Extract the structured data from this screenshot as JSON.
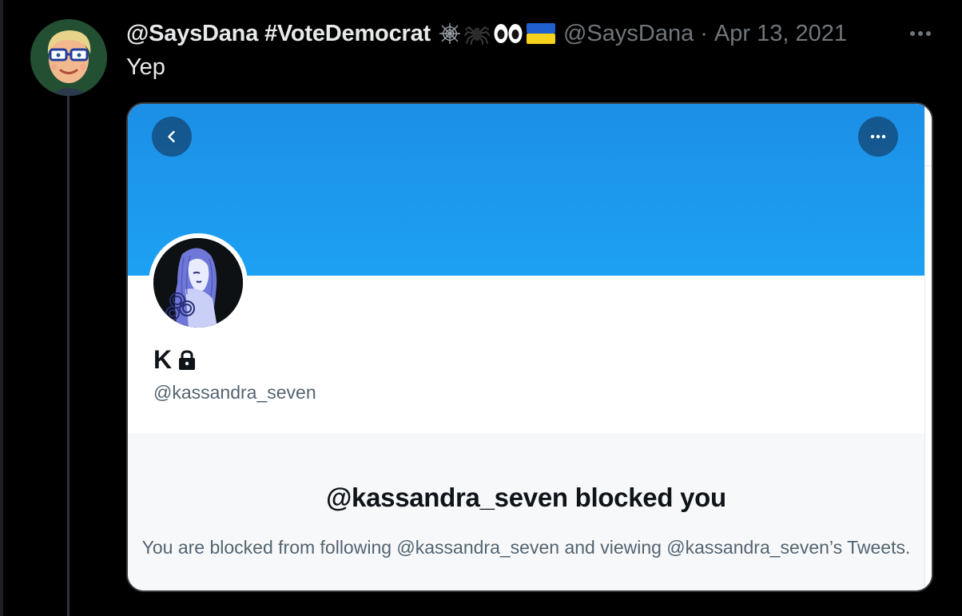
{
  "tweet": {
    "display_name": "@SaysDana #VoteDemocrat",
    "name_emojis": [
      "spider-web",
      "spider",
      "eyes",
      "ukraine-flag"
    ],
    "handle": "@SaysDana",
    "separator": "·",
    "date": "Apr 13, 2021",
    "text": "Yep"
  },
  "embedded_profile": {
    "name": "K",
    "handle": "@kassandra_seven",
    "locked": true,
    "banner_color": "#1da1f2",
    "blocked_title": "@kassandra_seven blocked you",
    "blocked_description": "You are blocked from following @kassandra_seven and viewing @kassandra_seven’s Tweets."
  },
  "colors": {
    "background": "#000000",
    "primary_text": "#e7e9ea",
    "secondary_text": "#71767b",
    "accent_blue": "#1da1f2"
  }
}
